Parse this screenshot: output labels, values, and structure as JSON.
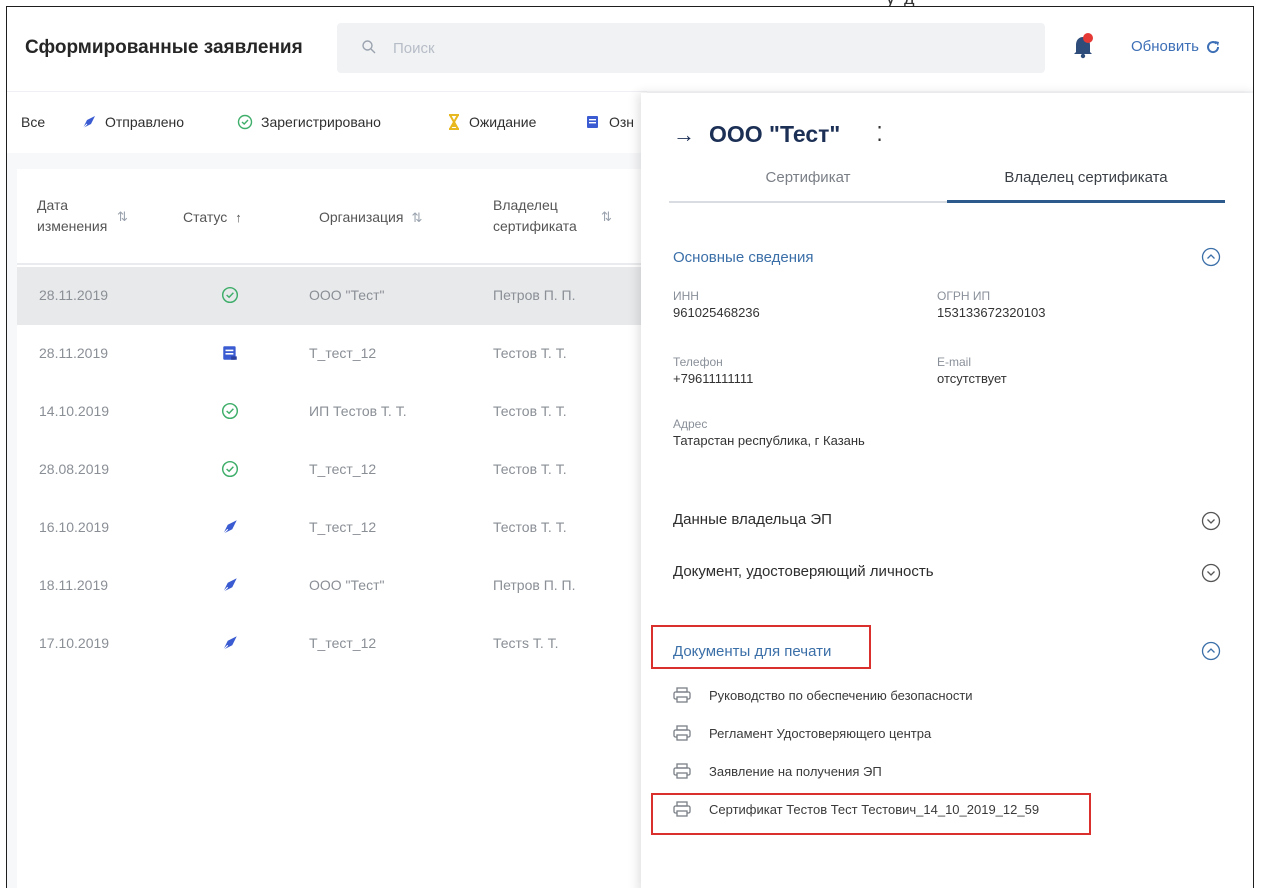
{
  "top_fragment": "у д",
  "header": {
    "title": "Сформированные заявления",
    "search_placeholder": "Поиск",
    "refresh_label": "Обновить"
  },
  "filters": [
    {
      "label": "Все",
      "icon": "none"
    },
    {
      "label": "Отправлено",
      "icon": "paper-plane-icon"
    },
    {
      "label": "Зарегистрировано",
      "icon": "check-circle-icon"
    },
    {
      "label": "Ожидание",
      "icon": "hourglass-icon"
    },
    {
      "label": "Озн",
      "icon": "document-icon"
    }
  ],
  "table": {
    "columns": [
      "Дата изменения",
      "Статус",
      "Организация",
      "Владелец сертификата"
    ],
    "rows": [
      {
        "date": "28.11.2019",
        "status": "registered",
        "org": "ООО \"Тест\"",
        "owner": "Петров П. П."
      },
      {
        "date": "28.11.2019",
        "status": "document",
        "org": "Т_тест_12",
        "owner": "Тестов Т. Т."
      },
      {
        "date": "14.10.2019",
        "status": "registered",
        "org": "ИП Тестов Т. Т.",
        "owner": "Тестов Т. Т."
      },
      {
        "date": "28.08.2019",
        "status": "registered",
        "org": "Т_тест_12",
        "owner": "Тестов Т. Т."
      },
      {
        "date": "16.10.2019",
        "status": "sent",
        "org": "Т_тест_12",
        "owner": "Тестов Т. Т."
      },
      {
        "date": "18.11.2019",
        "status": "sent",
        "org": "ООО \"Тест\"",
        "owner": "Петров П. П."
      },
      {
        "date": "17.10.2019",
        "status": "sent",
        "org": "Т_тест_12",
        "owner": "Тестs Т. Т."
      }
    ]
  },
  "panel": {
    "title": "ООО \"Тест\"",
    "tabs": [
      "Сертификат",
      "Владелец сертификата"
    ],
    "active_tab": "Владелец сертификата",
    "main_info": {
      "heading": "Основные сведения",
      "inn_label": "ИНН",
      "inn_value": "961025468236",
      "ogrn_label": "ОГРН ИП",
      "ogrn_value": "153133672320103",
      "phone_label": "Телефон",
      "phone_value": "+79611111111",
      "email_label": "E-mail",
      "email_value": "отсутствует",
      "address_label": "Адрес",
      "address_value": "Татарстан республика, г Казань"
    },
    "owner_data_heading": "Данные владельца ЭП",
    "id_doc_heading": "Документ, удостоверяющий личность",
    "print_docs_heading": "Документы для печати",
    "print_docs": [
      "Руководство по обеспечению безопасности",
      "Регламент Удостоверяющего центра",
      "Заявление на получения ЭП",
      "Сертификат Тестов Тест Тестович_14_10_2019_12_59"
    ]
  },
  "colors": {
    "accent_blue": "#3b6fa8",
    "title_navy": "#1c2f55",
    "status_green": "#3fae6a",
    "status_blue": "#3a5bd1",
    "notification_red": "#e53935",
    "highlight_red": "#d9302d"
  }
}
